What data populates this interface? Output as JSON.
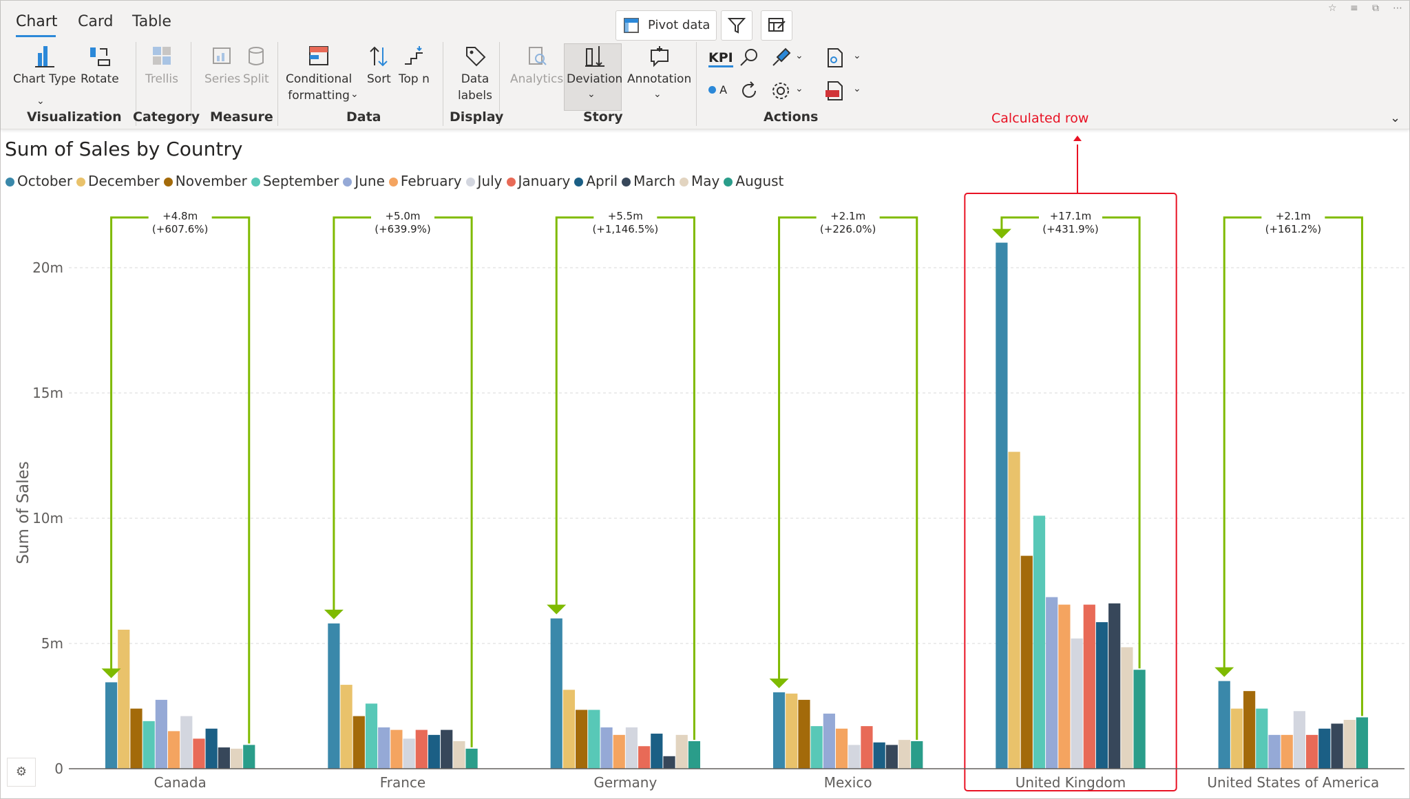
{
  "tabs": [
    {
      "label": "Chart",
      "active": true
    },
    {
      "label": "Card",
      "active": false
    },
    {
      "label": "Table",
      "active": false
    }
  ],
  "toolbar": {
    "pivot_label": "Pivot data",
    "buttons": {
      "chart_type": "Chart Type",
      "rotate": "Rotate",
      "trellis": "Trellis",
      "series": "Series",
      "split": "Split",
      "conditional_1": "Conditional",
      "conditional_2": "formatting",
      "sort": "Sort",
      "top_n": "Top n",
      "data_labels_1": "Data",
      "data_labels_2": "labels",
      "analytics": "Analytics",
      "deviation": "Deviation",
      "annotation": "Annotation",
      "kpi": "KPI",
      "oa": "A"
    },
    "groups": {
      "visualization": "Visualization",
      "category": "Category",
      "measure": "Measure",
      "data": "Data",
      "display": "Display",
      "story": "Story",
      "actions": "Actions"
    }
  },
  "annotation": {
    "calculated_row": "Calculated row",
    "color": "#e81123"
  },
  "colors": {
    "accent": "#2b88d8",
    "deviation": "#7fba00"
  },
  "chart_data": {
    "type": "bar",
    "title": "Sum of  Sales by Country",
    "xlabel": "",
    "ylabel": "Sum of Sales",
    "ylim": [
      0,
      22000000
    ],
    "yticks": [
      {
        "value": 0,
        "label": "0"
      },
      {
        "value": 5000000,
        "label": "5m"
      },
      {
        "value": 10000000,
        "label": "10m"
      },
      {
        "value": 15000000,
        "label": "15m"
      },
      {
        "value": 20000000,
        "label": "20m"
      }
    ],
    "grid": true,
    "legend_position": "top-left",
    "categories": [
      "Canada",
      "France",
      "Germany",
      "Mexico",
      "United Kingdom",
      "United States of America"
    ],
    "series": [
      {
        "name": "October",
        "color": "#3a88aa",
        "values": [
          3450000,
          5800000,
          6000000,
          3050000,
          21000000,
          3500000
        ]
      },
      {
        "name": "December",
        "color": "#e9c26b",
        "values": [
          5550000,
          3350000,
          3150000,
          3000000,
          12650000,
          2400000
        ]
      },
      {
        "name": "November",
        "color": "#a36a0a",
        "values": [
          2400000,
          2100000,
          2350000,
          2750000,
          8500000,
          3100000
        ]
      },
      {
        "name": "September",
        "color": "#58c8b7",
        "values": [
          1900000,
          2600000,
          2350000,
          1700000,
          10100000,
          2400000
        ]
      },
      {
        "name": "June",
        "color": "#95a9d6",
        "values": [
          2750000,
          1650000,
          1650000,
          2200000,
          6850000,
          1350000
        ]
      },
      {
        "name": "February",
        "color": "#f4a460",
        "values": [
          1500000,
          1550000,
          1350000,
          1600000,
          6550000,
          1350000
        ]
      },
      {
        "name": "July",
        "color": "#d3d6df",
        "values": [
          2100000,
          1200000,
          1650000,
          950000,
          5200000,
          2300000
        ]
      },
      {
        "name": "January",
        "color": "#e86a57",
        "values": [
          1200000,
          1550000,
          900000,
          1700000,
          6550000,
          1350000
        ]
      },
      {
        "name": "April",
        "color": "#1b5f85",
        "values": [
          1600000,
          1350000,
          1400000,
          1050000,
          5850000,
          1600000
        ]
      },
      {
        "name": "March",
        "color": "#37475a",
        "values": [
          850000,
          1550000,
          500000,
          950000,
          6600000,
          1800000
        ]
      },
      {
        "name": "May",
        "color": "#e2d4c0",
        "values": [
          800000,
          1100000,
          1350000,
          1150000,
          4850000,
          1950000
        ]
      },
      {
        "name": "August",
        "color": "#2a9d8a",
        "values": [
          950000,
          800000,
          1100000,
          1100000,
          3950000,
          2050000
        ]
      }
    ],
    "deviations": [
      {
        "category": "Canada",
        "delta": "+4.8m",
        "pct": "(+607.6%)"
      },
      {
        "category": "France",
        "delta": "+5.0m",
        "pct": "(+639.9%)"
      },
      {
        "category": "Germany",
        "delta": "+5.5m",
        "pct": "(+1,146.5%)"
      },
      {
        "category": "Mexico",
        "delta": "+2.1m",
        "pct": "(+226.0%)"
      },
      {
        "category": "United Kingdom",
        "delta": "+17.1m",
        "pct": "(+431.9%)"
      },
      {
        "category": "United States of America",
        "delta": "+2.1m",
        "pct": "(+161.2%)"
      }
    ],
    "highlighted_category": "United Kingdom"
  }
}
